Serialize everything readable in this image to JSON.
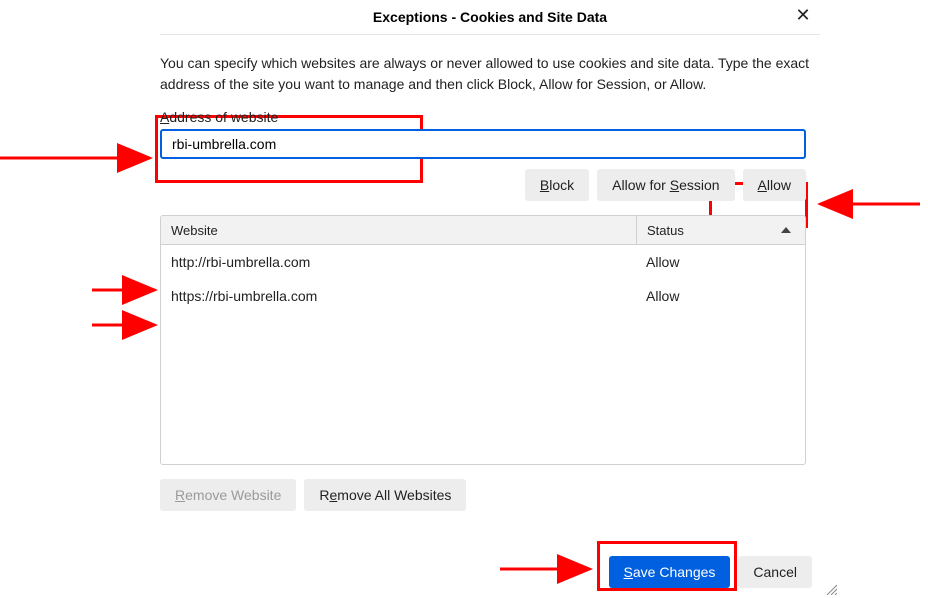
{
  "dialog": {
    "title": "Exceptions - Cookies and Site Data",
    "description": "You can specify which websites are always or never allowed to use cookies and site data. Type the exact address of the site you want to manage and then click Block, Allow for Session, or Allow.",
    "close_aria": "Close"
  },
  "address": {
    "label_prefix": "A",
    "label_rest": "ddress of website",
    "value": "rbi-umbrella.com"
  },
  "buttons": {
    "block_prefix": "B",
    "block_rest": "lock",
    "afs_prefix": "Allow for ",
    "afs_under": "S",
    "afs_rest": "ession",
    "allow_under": "A",
    "allow_rest": "llow",
    "remove_under": "R",
    "remove_rest": "emove Website",
    "remove_all_under": "e",
    "remove_all_prefix": "R",
    "remove_all_rest": "move All Websites",
    "save_under": "S",
    "save_rest": "ave Changes",
    "cancel": "Cancel"
  },
  "table": {
    "col_website": "Website",
    "col_status": "Status",
    "rows": [
      {
        "site": "http://rbi-umbrella.com",
        "status": "Allow"
      },
      {
        "site": "https://rbi-umbrella.com",
        "status": "Allow"
      }
    ]
  }
}
